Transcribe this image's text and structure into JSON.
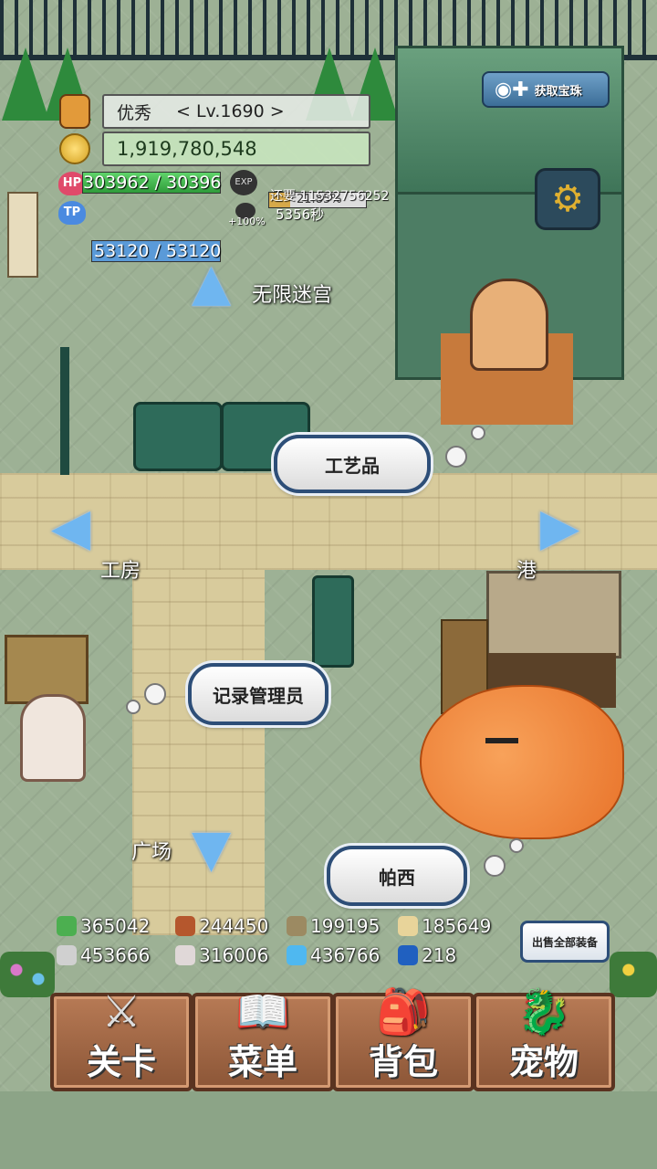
{
  "player": {
    "name": "优秀",
    "level": "< Lv.1690 >",
    "gold": "1,919,780,548",
    "hp_label": "HP",
    "hp": "303962 / 30396",
    "hp_fraction": 1.0,
    "tp_label": "TP",
    "tp": "53120 / 53120",
    "exp_label": "EXP",
    "exp_percent": "21.85%",
    "exp_fraction": 0.2185,
    "exp_remaining": "还要 11532756252",
    "exp_bonus": "+100%",
    "timer": "5356秒"
  },
  "top_right_button": "获取宝珠",
  "map_labels": {
    "infinite_maze": "无限迷宫",
    "workshop": "工房",
    "port": "港",
    "plaza": "广场"
  },
  "npc_bubbles": {
    "crafts": "工艺品",
    "recorder": "记录管理员",
    "percy": "帕西"
  },
  "resources": [
    {
      "icon": "herb-icon",
      "value": "365042",
      "color": "#4caf50"
    },
    {
      "icon": "meat-icon",
      "value": "244450",
      "color": "#b5572d"
    },
    {
      "icon": "wood-icon",
      "value": "199195",
      "color": "#9c8a62"
    },
    {
      "icon": "seed-icon",
      "value": "185649",
      "color": "#e8d49a"
    },
    {
      "icon": "iron-icon",
      "value": "453666",
      "color": "#d0d0d0"
    },
    {
      "icon": "stone-icon",
      "value": "316006",
      "color": "#e0d8d8"
    },
    {
      "icon": "water-icon",
      "value": "436766",
      "color": "#4fb8f0"
    },
    {
      "icon": "orb-icon",
      "value": "218",
      "color": "#2060c0"
    }
  ],
  "sell_all_button": "出售全部装备",
  "menu": [
    {
      "icon": "crossed-swords-icon",
      "label": "关卡"
    },
    {
      "icon": "book-icon",
      "label": "菜单"
    },
    {
      "icon": "backpack-icon",
      "label": "背包"
    },
    {
      "icon": "dragon-icon",
      "label": "宠物"
    }
  ]
}
